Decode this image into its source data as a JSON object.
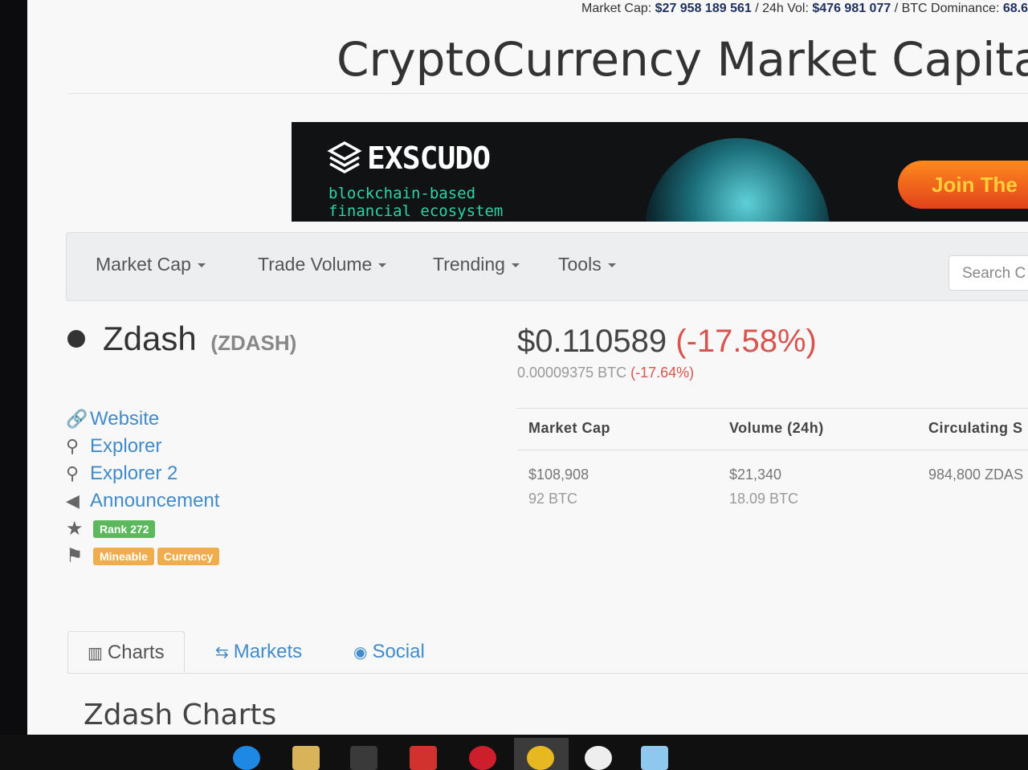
{
  "topbar": {
    "prefix": "Market Cap: ",
    "market_cap": "$27 958 189 561",
    "vol_label": " / 24h Vol: ",
    "volume": "$476 981 077",
    "dom_label": " / BTC Dominance: ",
    "dominance": "68.6"
  },
  "site_title": "CryptoCurrency Market Capitalizatio",
  "banner": {
    "brand": "EXSCUDO",
    "tagline_1": "blockchain-based",
    "tagline_2": "financial ecosystem",
    "cta": "Join The"
  },
  "nav": {
    "items": [
      {
        "label": "Market Cap"
      },
      {
        "label": "Trade Volume"
      },
      {
        "label": "Trending"
      },
      {
        "label": "Tools"
      }
    ],
    "search_placeholder": "Search C"
  },
  "coin": {
    "name": "Zdash",
    "symbol": "(ZDASH)",
    "price_usd": "$0.110589",
    "change_usd": "(-17.58%)",
    "price_btc": "0.00009375 BTC",
    "change_btc": "(-17.64%)"
  },
  "links": [
    {
      "icon": "link-icon",
      "label": "Website"
    },
    {
      "icon": "search-icon",
      "label": "Explorer"
    },
    {
      "icon": "search-icon",
      "label": "Explorer 2"
    },
    {
      "icon": "bullhorn-icon",
      "label": "Announcement"
    }
  ],
  "rank": "Rank 272",
  "tags": [
    "Mineable",
    "Currency"
  ],
  "stats": [
    {
      "header": "Market Cap",
      "value": "$108,908",
      "sub": "92 BTC"
    },
    {
      "header": "Volume (24h)",
      "value": "$21,340",
      "sub": "18.09 BTC"
    },
    {
      "header": "Circulating S",
      "value": "984,800 ZDAS",
      "sub": ""
    }
  ],
  "tabs": [
    {
      "label": "Charts",
      "icon": "bar-chart-icon",
      "active": true
    },
    {
      "label": "Markets",
      "icon": "exchange-icon",
      "active": false
    },
    {
      "label": "Social",
      "icon": "globe-icon",
      "active": false
    }
  ],
  "section_title": "Zdash Charts",
  "colors": {
    "link": "#428bca",
    "negative": "#d9534f",
    "rank_badge": "#5cb85c",
    "tag_badge": "#f0ad4e",
    "banner_accent": "#2cd4a8"
  }
}
